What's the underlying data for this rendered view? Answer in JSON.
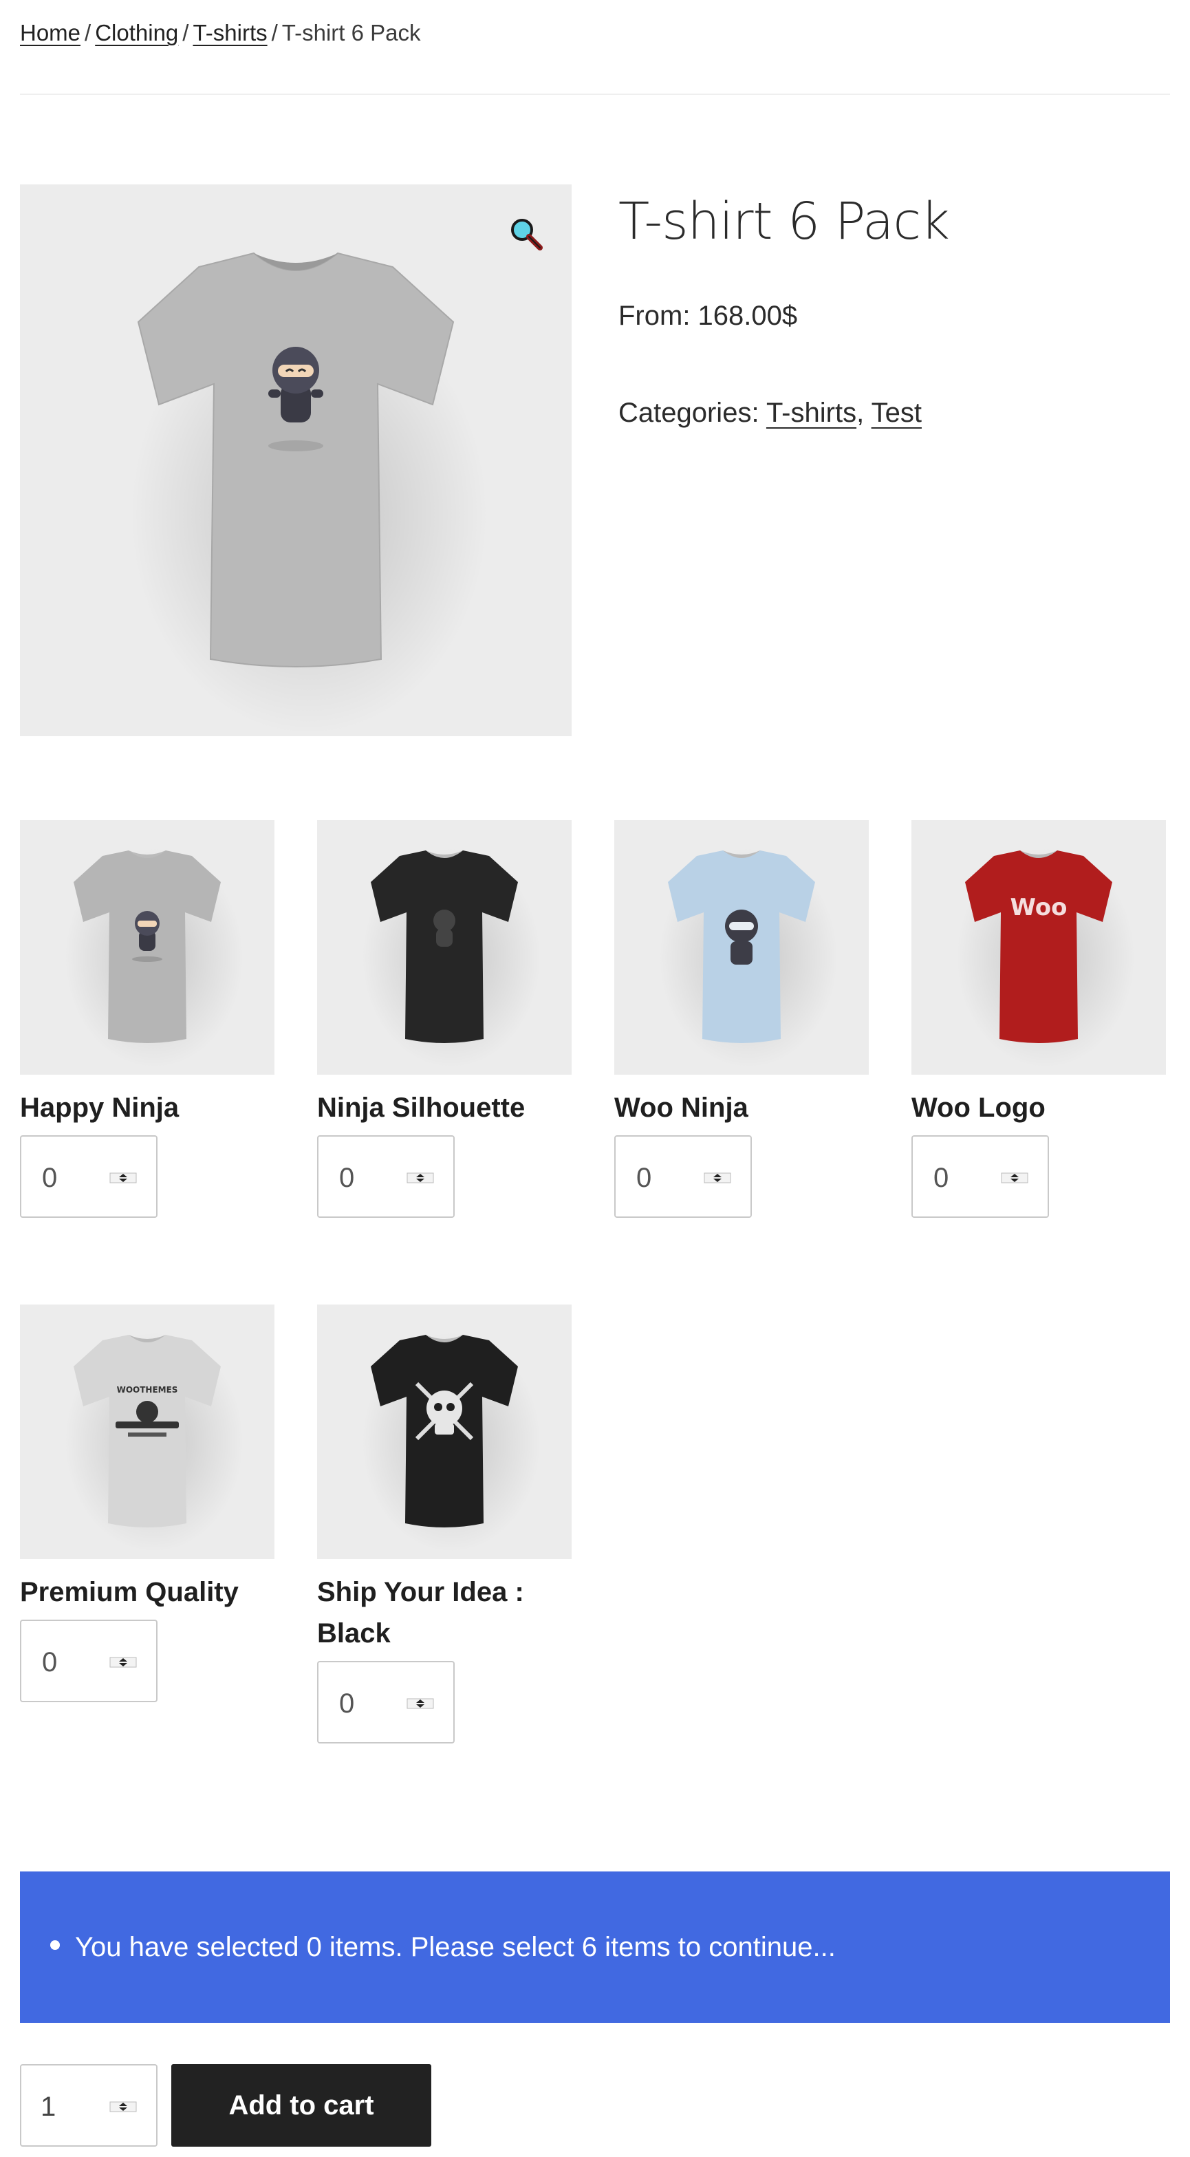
{
  "breadcrumb": {
    "items": [
      {
        "label": "Home",
        "link": true
      },
      {
        "label": "Clothing",
        "link": true
      },
      {
        "label": "T-shirts",
        "link": true
      },
      {
        "label": "T-shirt 6 Pack",
        "link": false
      }
    ],
    "separator": "/"
  },
  "product": {
    "title": "T-shirt 6 Pack",
    "price": "From: 168.00$",
    "categories_label": "Categories:",
    "categories": [
      "T-shirts",
      "Test"
    ],
    "category_separator": ",",
    "zoom_icon": "magnifier-icon",
    "main_image": {
      "color": "#b9b9b9",
      "graphic": "ninja"
    }
  },
  "bundle_items": [
    {
      "name": "Happy Ninja",
      "quantity": "0",
      "shirt_color": "#b5b5b5",
      "graphic": "ninja"
    },
    {
      "name": "Ninja Silhouette",
      "quantity": "0",
      "shirt_color": "#262626",
      "graphic": "silhouette"
    },
    {
      "name": "Woo Ninja",
      "quantity": "0",
      "shirt_color": "#b9d1e6",
      "graphic": "woo-ninja"
    },
    {
      "name": "Woo Logo",
      "quantity": "0",
      "shirt_color": "#b11d1d",
      "graphic": "woo-logo",
      "logo_text": "Woo"
    },
    {
      "name": "Premium Quality",
      "quantity": "0",
      "shirt_color": "#d6d6d6",
      "graphic": "premium",
      "logo_text": "WOOTHEMES"
    },
    {
      "name": "Ship Your Idea : Black",
      "quantity": "0",
      "shirt_color": "#1f1f1f",
      "graphic": "skull"
    }
  ],
  "notice": {
    "message": "You have selected 0 items. Please select 6 items to continue...",
    "color": "#4169e1"
  },
  "cart": {
    "quantity": "1",
    "add_to_cart_label": "Add to cart"
  }
}
